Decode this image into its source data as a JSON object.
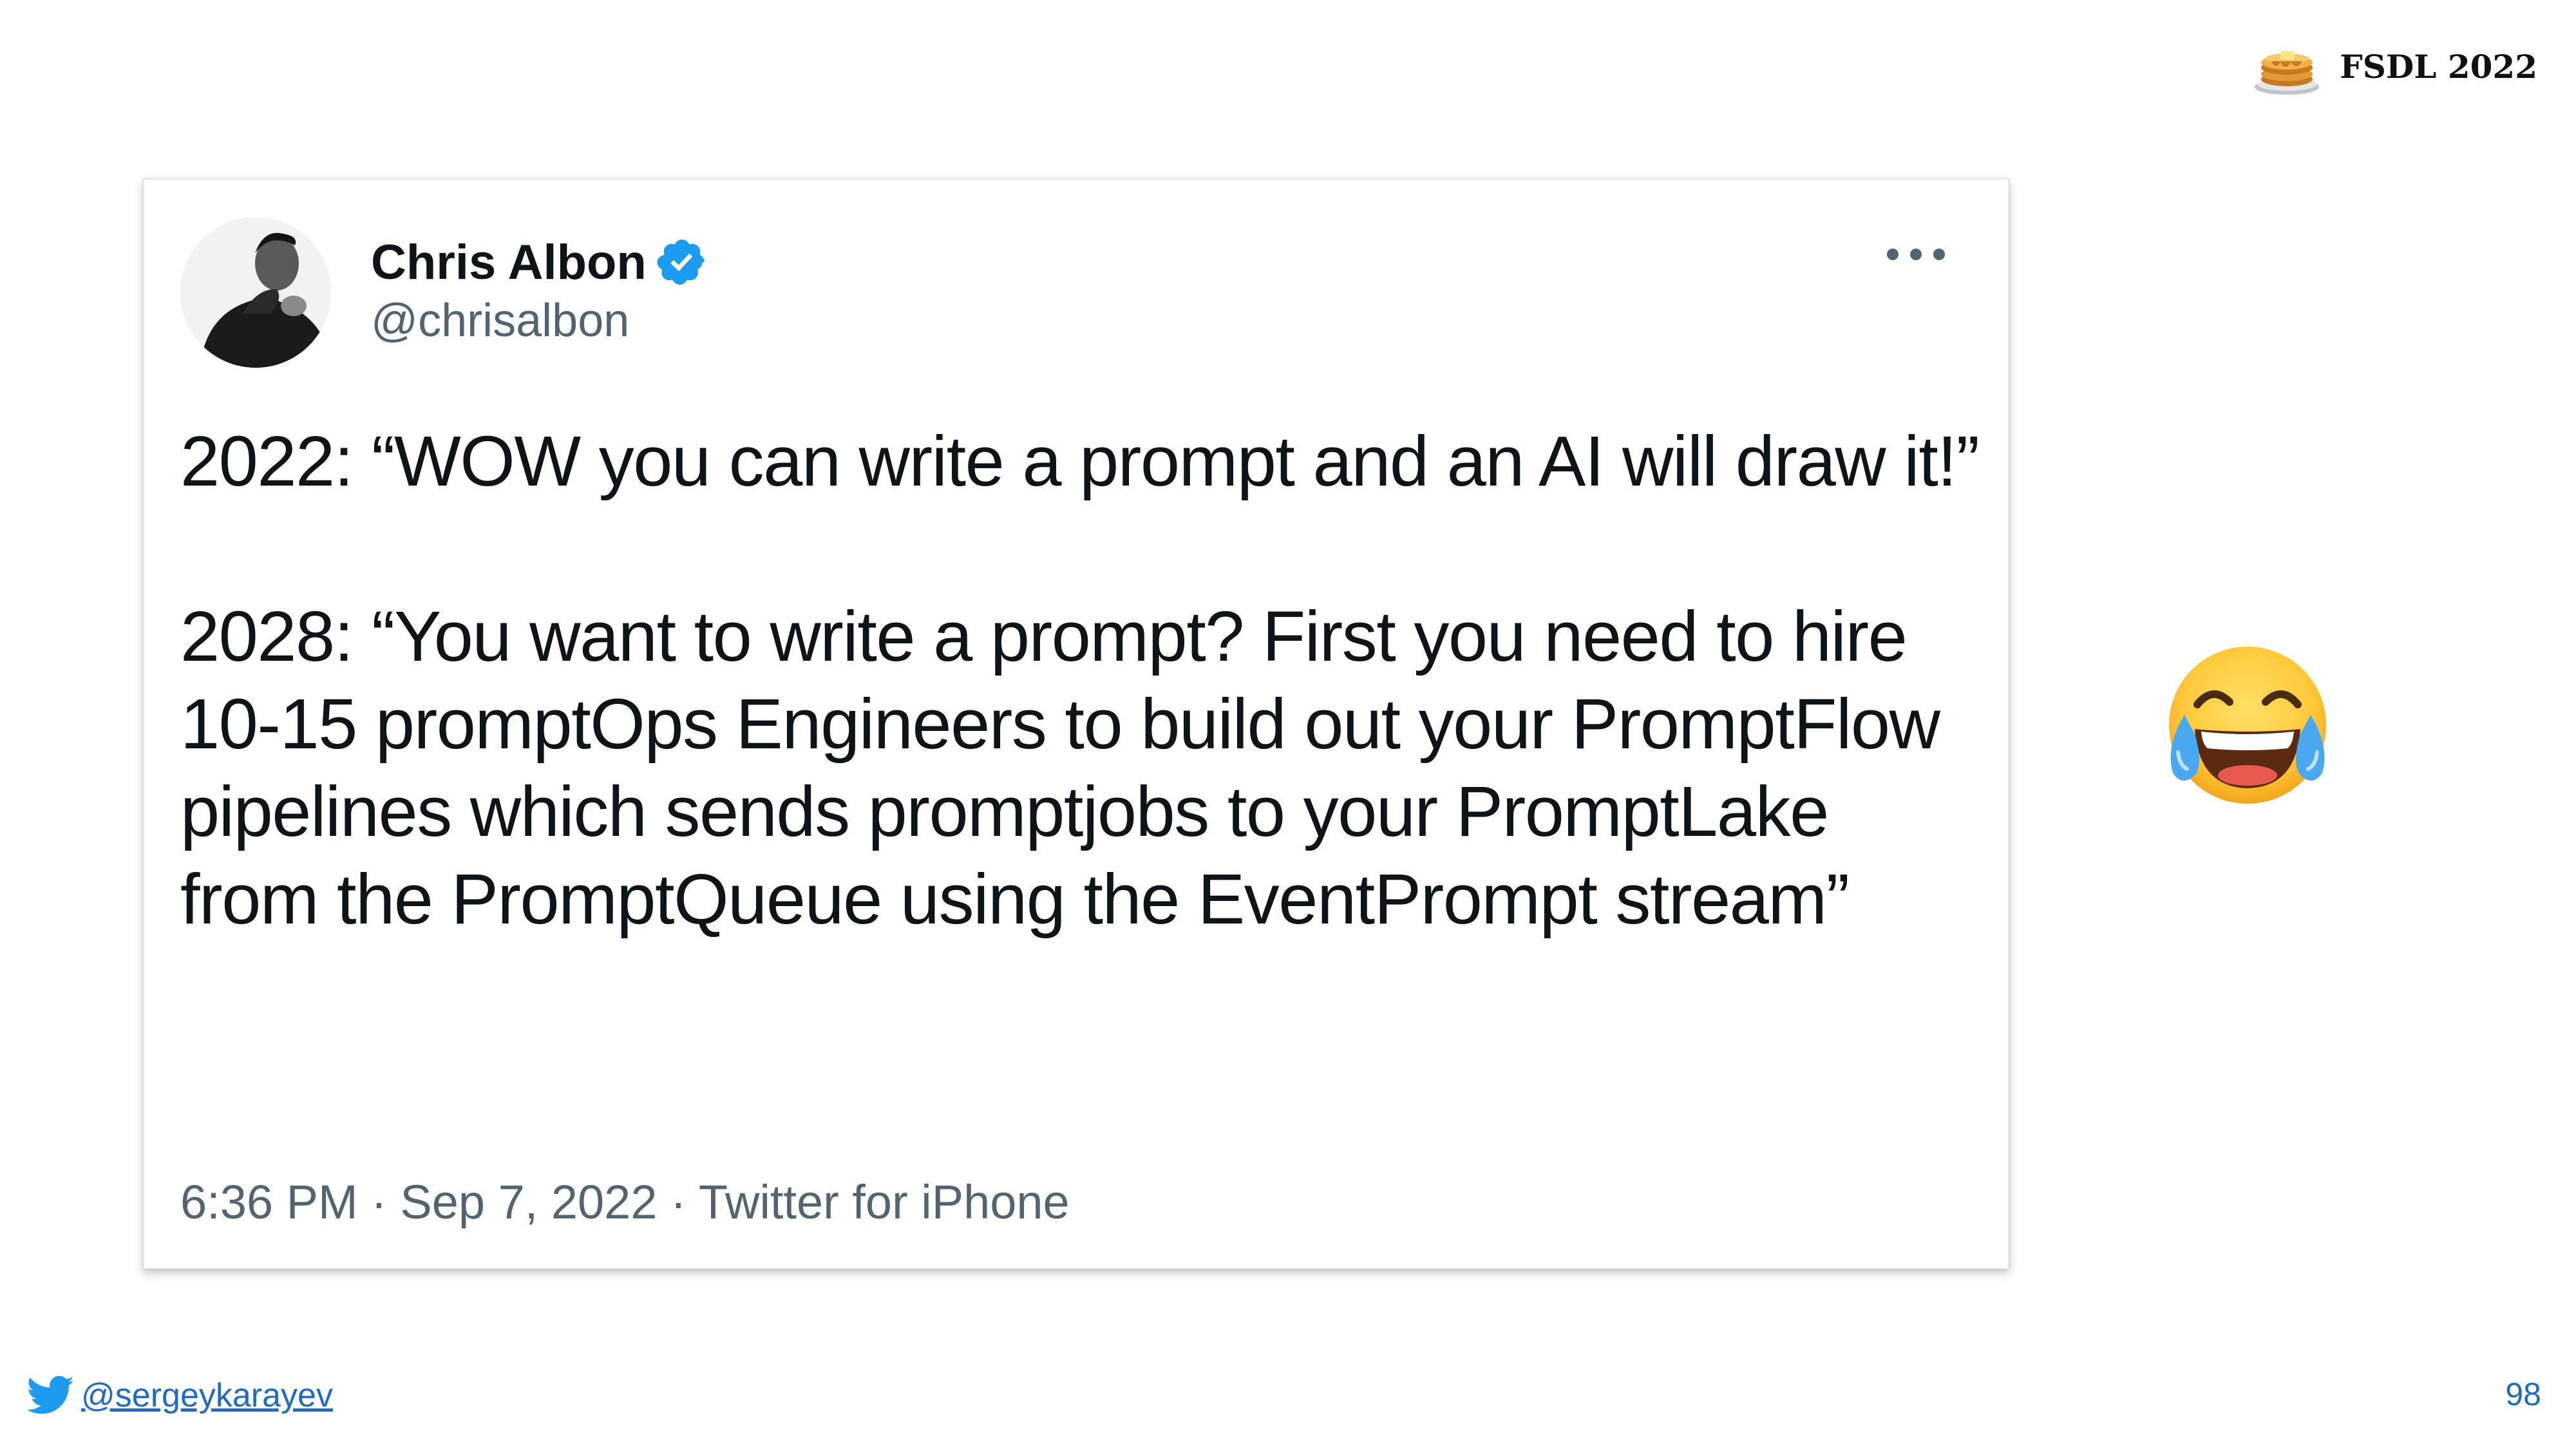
{
  "course_badge": {
    "icon": "pancake-stack-icon",
    "title": "FSDL 2022"
  },
  "tweet": {
    "author_name": "Chris Albon",
    "verified": true,
    "verified_color": "#1d9bf0",
    "handle": "@chrisalbon",
    "more_icon": "more-horizontal-icon",
    "text_paragraphs": [
      "2022: “WOW you can write a prompt and an AI will draw it!”",
      "2028: “You want to write a prompt? First you need to hire 10-15 promptOps Engineers to build out your PromptFlow pipelines which sends promptjobs to your PromptLake from the PromptQueue using the EventPrompt stream”"
    ],
    "meta": "6:36 PM · Sep 7, 2022 · Twitter for iPhone"
  },
  "reaction_emoji": "face-with-tears-of-joy-icon",
  "footer": {
    "twitter_icon": "twitter-bird-icon",
    "twitter_handle": "@sergeykarayev",
    "slide_number": "98"
  },
  "colors": {
    "link": "#1d6bc7",
    "secondary_text": "#536471",
    "primary_text": "#0f1419"
  }
}
